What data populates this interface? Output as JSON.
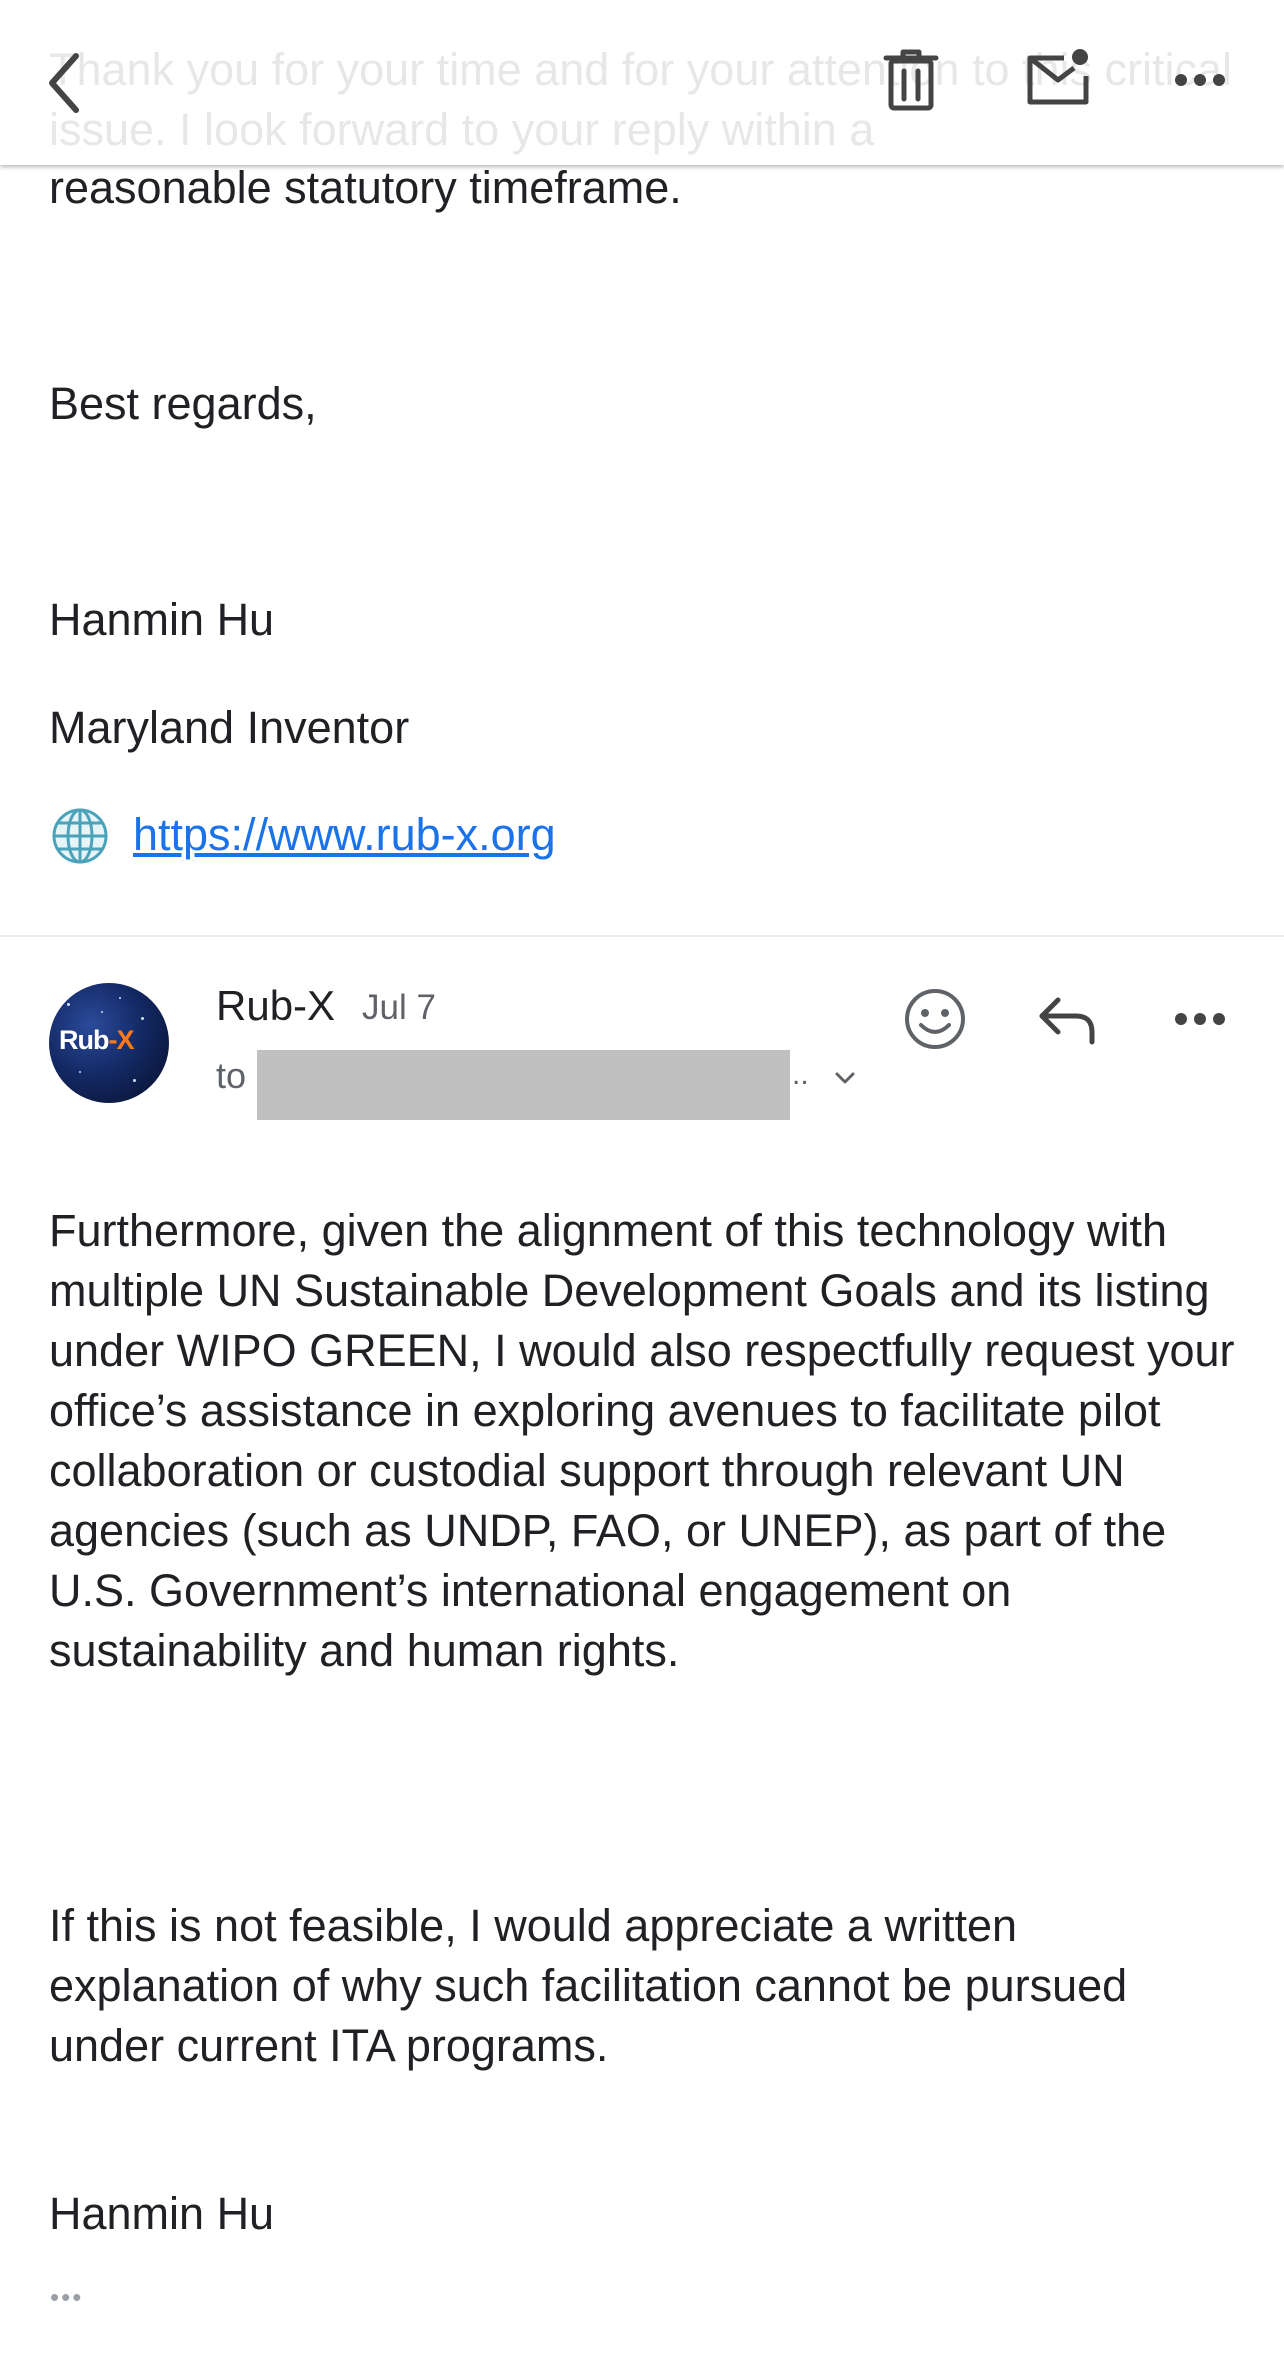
{
  "header": {
    "back_icon": "back-chevron-icon",
    "actions": [
      "trash-icon",
      "mark-unread-icon",
      "more-horizontal-icon"
    ],
    "scrolled_text": "Thank you for your time and for your attention to this critical issue. I look forward to your reply within a"
  },
  "previous_message": {
    "body_tail": "reasonable statutory timeframe.",
    "closing": "Best regards,",
    "signature_name": "Hanmin Hu",
    "signature_title": "Maryland Inventor",
    "globe_icon": "globe-icon",
    "website": "https://www.rub-x.org"
  },
  "message": {
    "avatar_text": "Rub-X",
    "sender": "Rub-X",
    "date": "Jul 7",
    "to_label": "to",
    "recipient_truncation": "..",
    "paragraph1": "Furthermore, given the alignment of this technology with multiple UN Sustainable Development Goals and its listing under WIPO GREEN, I would also respectfully request your office’s assistance in exploring avenues to facilitate pilot collaboration or custodial support through relevant UN agencies (such as UNDP, FAO, or UNEP), as part of the U.S. Government’s international engagement on sustainability and human rights.",
    "paragraph2": "If this is not feasible, I would appreciate a written explanation of why such facilitation cannot be pursued under current ITA programs.",
    "signature_name": "Hanmin Hu",
    "trimmed_content_label": "•••"
  },
  "colors": {
    "link": "#1a73e8",
    "text": "#202124",
    "secondary_text": "#5f6368",
    "redaction": "#c0c0c0"
  }
}
